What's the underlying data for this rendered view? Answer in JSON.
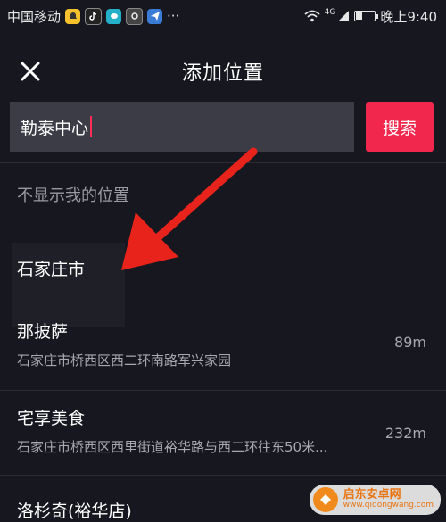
{
  "status_bar": {
    "carrier": "中国移动",
    "more_indicator": "···",
    "network": "4G",
    "time": "晚上9:40",
    "battery_level": 0.3,
    "app_icons": [
      "bell-app-icon",
      "tiktok-app-icon",
      "chat-app-icon",
      "camera-app-icon",
      "paper-plane-app-icon"
    ]
  },
  "header": {
    "title": "添加位置",
    "close_icon": "close-icon"
  },
  "search": {
    "value": "勒泰中心",
    "button_label": "搜索"
  },
  "hint": "不显示我的位置",
  "locations": [
    {
      "name": "石家庄市",
      "address": "",
      "distance": ""
    },
    {
      "name": "那披萨",
      "address": "石家庄市桥西区西二环南路军兴家园",
      "distance": "89m"
    },
    {
      "name": "宅享美食",
      "address": "石家庄市桥西区西里街道裕华路与西二环往东50米...",
      "distance": "232m"
    },
    {
      "name": "洛杉奇(裕华店)",
      "address": "",
      "distance": ""
    }
  ],
  "watermark": {
    "cn": "启东安卓网",
    "en": "www.qidongwang.com"
  },
  "colors": {
    "background": "#16171f",
    "search_field": "#3b3c45",
    "accent": "#f1274e",
    "arrow": "#e8231c"
  }
}
